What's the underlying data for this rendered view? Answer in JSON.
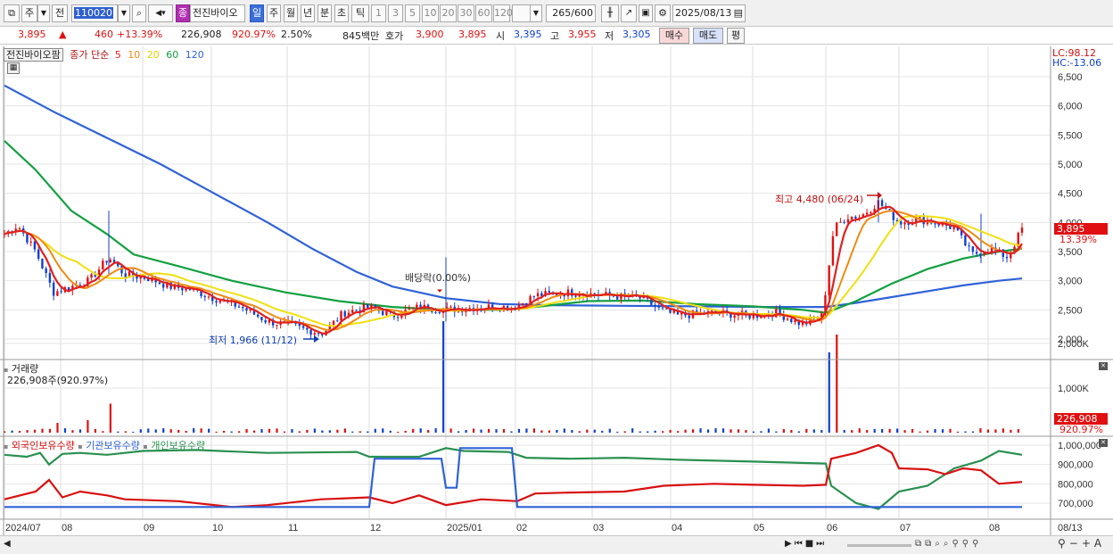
{
  "toolbar": {
    "market_type": "주",
    "prev_label": "전",
    "code": "110020",
    "badge": "종",
    "stock_name": "전진바이오",
    "periods": [
      "일",
      "주",
      "월",
      "년",
      "분",
      "초",
      "틱"
    ],
    "active_period": "일",
    "intervals": [
      "1",
      "3",
      "5",
      "10",
      "20",
      "30",
      "60",
      "120"
    ],
    "count": "265",
    "count_total": "/600",
    "date": "2025/08/13"
  },
  "quote": {
    "price": "3,895",
    "change_arrow": "▲",
    "change": "460",
    "change_pct": "+13.39%",
    "volume": "226,908",
    "volume_ratio": "920.97%",
    "turnover": "2.50%",
    "amount": "845백만",
    "bid_label": "호가",
    "bid1": "3,900",
    "bid2": "3,895",
    "open_label": "시",
    "open": "3,395",
    "high_label": "고",
    "high": "3,955",
    "low_label": "저",
    "low": "3,305",
    "buy_label": "매수",
    "sell_label": "매도",
    "flat_label": "평"
  },
  "price_panel": {
    "stock_label": "전진바이오팜",
    "ma_label": "종가 단순",
    "ma_periods": [
      "5",
      "10",
      "20",
      "60",
      "120"
    ],
    "ma_colors": [
      "#e02020",
      "#f08a10",
      "#f0e010",
      "#12a040",
      "#2f62d8"
    ],
    "lc": "LC:98.12",
    "hc": "HC:-13.06",
    "y_ticks": [
      "6,500",
      "6,000",
      "5,500",
      "5,000",
      "4,500",
      "4,000",
      "3,500",
      "3,000",
      "2,500",
      "2,000"
    ],
    "current_price": "3,895",
    "current_pct": "13.39%",
    "annotation_high": "최고 4,480 (06/24)",
    "annotation_low": "최저 1,966 (11/12)",
    "annotation_dividend": "배당락(0.00%)"
  },
  "volume_panel": {
    "title": "거래량",
    "value_label": "226,908주(920.97%)",
    "y_ticks": [
      "2,000K",
      "1,000K"
    ],
    "current": "226,908",
    "current_pct": "920.97%"
  },
  "holding_panel": {
    "legend": [
      "외국인보유수량",
      "기관보유수량",
      "개인보유수량"
    ],
    "legend_colors": [
      "#d81010",
      "#2f62d8",
      "#2a9050"
    ],
    "y_ticks": [
      "1,000,000",
      "900,000",
      "800,000",
      "700,000"
    ]
  },
  "xaxis": {
    "labels": [
      "2024/07",
      "08",
      "09",
      "10",
      "11",
      "12",
      "2025/01",
      "02",
      "03",
      "04",
      "05",
      "06",
      "07",
      "08"
    ],
    "right_label": "08/13"
  },
  "chart_data": [
    {
      "type": "line",
      "title": "",
      "x": [
        "2024/07",
        "08",
        "09",
        "10",
        "11",
        "12",
        "2025/01",
        "02",
        "03",
        "04",
        "05",
        "06",
        "07",
        "08",
        "08/13"
      ],
      "series": [
        {
          "name": "5",
          "values": [
            3800,
            2900,
            2950,
            2700,
            2150,
            2500,
            2600,
            2550,
            2800,
            2400,
            2400,
            2300,
            4250,
            3900,
            3550,
            3550
          ]
        },
        {
          "name": "120",
          "values": [
            6350,
            5600,
            4800,
            4100,
            3400,
            3000,
            2700,
            2600,
            2580,
            2570,
            2560,
            2550,
            2650,
            2850,
            3000,
            3050
          ]
        }
      ],
      "ylim": [
        1800,
        6700
      ]
    },
    {
      "type": "bar",
      "title": "거래량",
      "categories": [
        "2024/08",
        "2025/01",
        "2025/06"
      ],
      "values": [
        650,
        2500,
        2250
      ],
      "ylabel": "K"
    }
  ]
}
